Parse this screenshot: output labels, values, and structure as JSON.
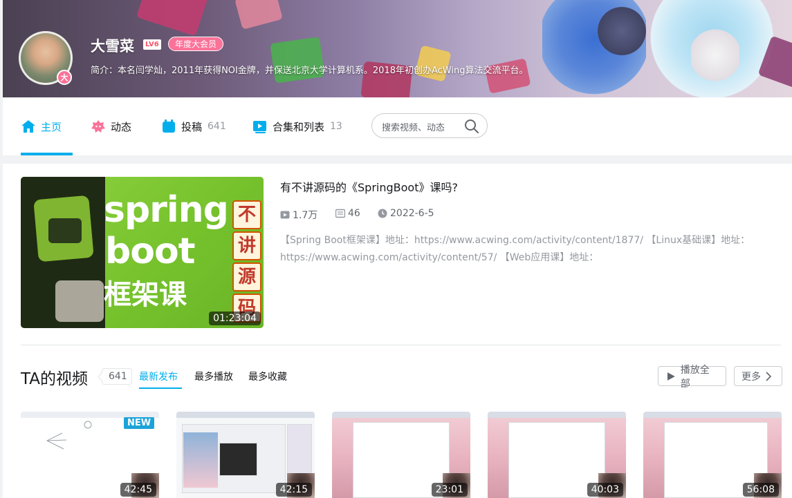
{
  "profile": {
    "name": "大雪菜",
    "level": "LV6",
    "vip_label": "年度大会员",
    "avatar_badge": "大",
    "bio": "简介：本名闫学灿，2011年获得NOI金牌，并保送北京大学计算机系。2018年初创办AcWing算法交流平台。"
  },
  "nav": {
    "items": [
      {
        "label": "主页",
        "count": "",
        "icon": "home-icon"
      },
      {
        "label": "动态",
        "count": "",
        "icon": "dynamic-icon"
      },
      {
        "label": "投稿",
        "count": "641",
        "icon": "upload-icon"
      },
      {
        "label": "合集和列表",
        "count": "13",
        "icon": "collection-icon"
      }
    ],
    "search_placeholder": "搜索视频、动态"
  },
  "featured": {
    "thumb_text": [
      "spring",
      "boot",
      "框架课"
    ],
    "thumb_side": [
      "不",
      "讲",
      "源",
      "码"
    ],
    "duration": "01:23:04",
    "title": "有不讲源码的《SpringBoot》课吗?",
    "plays": "1.7万",
    "comments": "46",
    "date": "2022-6-5",
    "description": "【Spring Boot框架课】地址：https://www.acwing.com/activity/content/1877/ 【Linux基础课】地址：https://www.acwing.com/activity/content/57/ 【Web应用课】地址："
  },
  "videos_section": {
    "title": "TA的视频",
    "count": "641",
    "tabs": [
      "最新发布",
      "最多播放",
      "最多收藏"
    ],
    "play_all": "播放全部",
    "more": "更多",
    "new_badge": "NEW",
    "videos": [
      {
        "duration": "42:45"
      },
      {
        "duration": "42:15"
      },
      {
        "duration": "23:01"
      },
      {
        "duration": "40:03"
      },
      {
        "duration": "56:08"
      }
    ]
  },
  "colors": {
    "accent": "#00aeec",
    "pink": "#fb7299"
  }
}
